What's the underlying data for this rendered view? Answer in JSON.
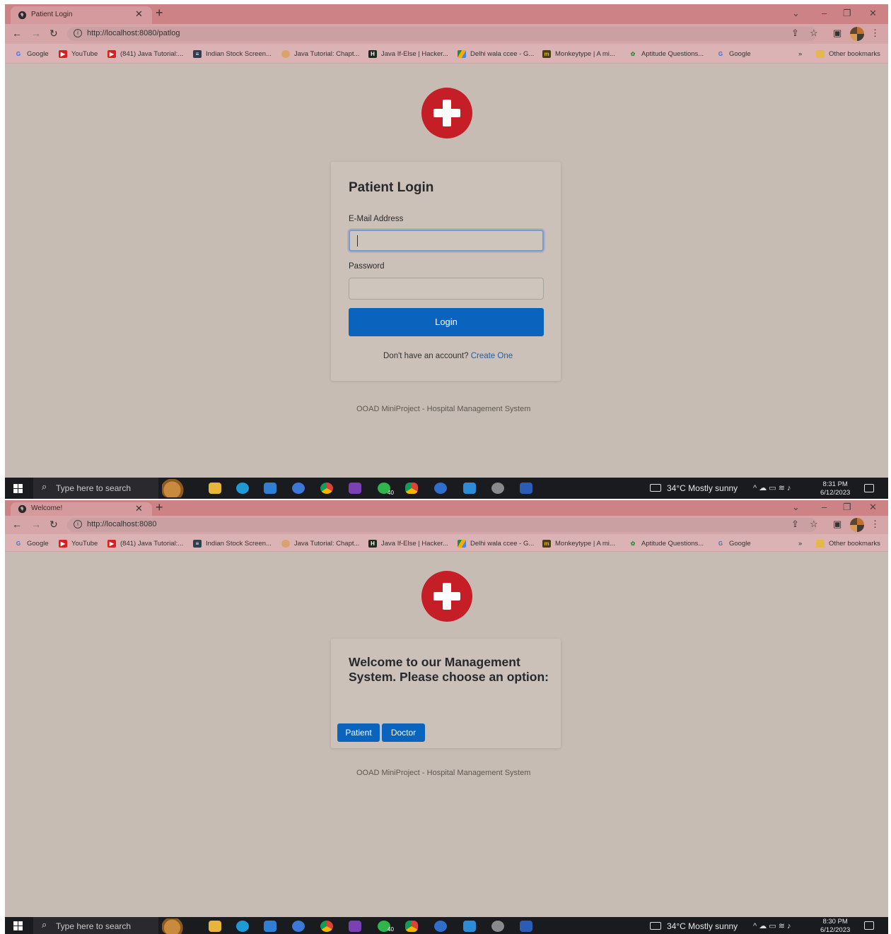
{
  "top": {
    "browser": {
      "tab_title": "Patient Login",
      "url": "http://localhost:8080/patlog"
    },
    "login": {
      "title": "Patient Login",
      "email_label": "E-Mail Address",
      "password_label": "Password",
      "login_button": "Login",
      "signup_prompt": "Don't have an account?",
      "signup_link": "Create One"
    },
    "footer": "OOAD MiniProject - Hospital Management System",
    "taskbar": {
      "search_placeholder": "Type here to search",
      "weather": "34°C  Mostly sunny",
      "time": "8:31 PM",
      "date": "6/12/2023",
      "badge_whatsapp": "40"
    }
  },
  "bottom": {
    "browser": {
      "tab_title": "Welcome!",
      "url": "http://localhost:8080"
    },
    "welcome": {
      "title": "Welcome to our Management System. Please choose an option:",
      "patient_button": "Patient",
      "doctor_button": "Doctor"
    },
    "footer": "OOAD MiniProject - Hospital Management System",
    "taskbar": {
      "search_placeholder": "Type here to search",
      "weather": "34°C  Mostly sunny",
      "time": "8:30 PM",
      "date": "6/12/2023",
      "badge_whatsapp": "40"
    }
  },
  "bookmarks": [
    {
      "label": "Google",
      "icon": "google-icon"
    },
    {
      "label": "YouTube",
      "icon": "youtube-icon"
    },
    {
      "label": "(841) Java Tutorial:...",
      "icon": "youtube-icon"
    },
    {
      "label": "Indian Stock Screen...",
      "icon": "screener-icon"
    },
    {
      "label": "Java Tutorial: Chapt...",
      "icon": "person-icon"
    },
    {
      "label": "Java If-Else | Hacker...",
      "icon": "hackerrank-icon"
    },
    {
      "label": "Delhi wala ccee - G...",
      "icon": "drive-icon"
    },
    {
      "label": "Monkeytype | A mi...",
      "icon": "monkeytype-icon"
    },
    {
      "label": "Aptitude Questions...",
      "icon": "indiabix-icon"
    },
    {
      "label": "Google",
      "icon": "google-icon"
    }
  ],
  "bookmarks_overflow": "»",
  "other_bookmarks": "Other bookmarks",
  "colors": {
    "tabbar": "#cd8385",
    "page_background": "#c6bcb3",
    "card_background": "#cbc1b8",
    "primary_button": "#0a64bd",
    "logo_red": "#c51e27",
    "taskbar": "#1a1b1f"
  }
}
